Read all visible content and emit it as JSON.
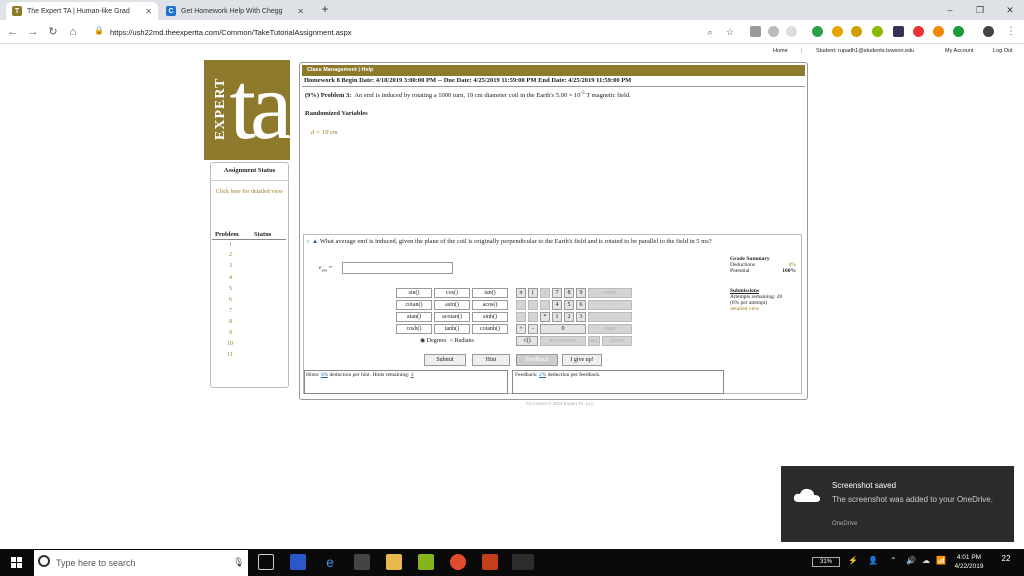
{
  "browser": {
    "tabs": [
      {
        "title": "The Expert TA | Human-like Grad",
        "active": true
      },
      {
        "title": "Get Homework Help With Chegg",
        "active": false
      }
    ],
    "new_tab": "+",
    "url": "https://ush22md.theexpertta.com/Common/TakeTutorialAssignment.aspx",
    "minimize": "–",
    "maximize": "❐",
    "close": "✕"
  },
  "topnav": {
    "home": "Home",
    "sep": "|",
    "student": "Student: rupadh1@students.towson.edu",
    "account": "My Account",
    "logout": "Log Out"
  },
  "logo": {
    "big": "ta",
    "side": "EXPERT"
  },
  "status": {
    "title": "Assignment Status",
    "link": "Click here for detailed view",
    "col_problem": "Problem",
    "col_status": "Status",
    "problems": [
      "1",
      "2",
      "3",
      "4",
      "5",
      "6",
      "7",
      "8",
      "9",
      "10",
      "11"
    ]
  },
  "assignment": {
    "menu": "Class Management  |  Help",
    "header": "Homework 8 Begin Date: 4/18/2019 3:00:00 PM -- Due Date: 4/25/2019 11:59:00 PM End Date: 4/25/2019 11:59:00 PM",
    "problem_prefix": "(9%) Problem 3:",
    "problem_text": "An emf is induced by rotating a 1000 turn, 19 cm diameter coil in the Earth's 5.00 × 10",
    "problem_exp": "-5",
    "problem_tail": " T magnetic field.",
    "randomized": "Randomized Variables",
    "variable": "d = 19 cm"
  },
  "question": {
    "text": "What average emf is induced, given the plane of the coil is originally perpendicular to the Earth's field and is rotated to be parallel to the field in 5 ms?",
    "answer_label": "ε",
    "answer_sub": "ave",
    "answer_eq": " =",
    "answer_value": ""
  },
  "grade": {
    "title": "Grade Summary",
    "deductions_label": "Deductions",
    "deductions": "0%",
    "potential_label": "Potential",
    "potential": "100%",
    "submissions_title": "Submissions",
    "attempts": "Attempts remaining: 20",
    "per_attempt": "(6% per attempt)",
    "detailed": "detailed view"
  },
  "calc": {
    "funcs": [
      [
        "sin()",
        "cos()",
        "tan()"
      ],
      [
        "cotan()",
        "asin()",
        "acos()"
      ],
      [
        "atan()",
        "acotan()",
        "sinh()"
      ],
      [
        "cosh()",
        "tanh()",
        "cotanh()"
      ]
    ],
    "pi": "π",
    "paren_open": "(",
    "paren_close": ")",
    "nums": [
      [
        "7",
        "8",
        "9"
      ],
      [
        "4",
        "5",
        "6"
      ],
      [
        "1",
        "2",
        "3"
      ]
    ],
    "zero": "0",
    "plus": "+",
    "minus": "-",
    "times": "*",
    "dot": ".",
    "sqrt": "√()",
    "home": "HOME",
    "end": "END",
    "backspace": "BACKSPACE",
    "del": "DEL",
    "clear": "CLEAR",
    "degrees": "Degrees",
    "radians": "Radians"
  },
  "buttons": {
    "submit": "Submit",
    "hint": "Hint",
    "feedback": "Feedback",
    "giveup": "I give up!"
  },
  "hints": {
    "label": "Hints:",
    "pct": "0%",
    "text": " deduction per hint. Hints remaining:",
    "remaining": "4"
  },
  "feedback": {
    "label": "Feedback:",
    "pct": "2%",
    "text": " deduction per feedback."
  },
  "copyright": "All content © 2019 Expert TA, LLC",
  "toast": {
    "title": "Screenshot saved",
    "body": "The screenshot was added to your OneDrive.",
    "app": "OneDrive"
  },
  "taskbar": {
    "search": "Type here to search",
    "battery": "31%",
    "time": "4:01 PM",
    "date": "4/22/2019",
    "notifications": "22"
  }
}
